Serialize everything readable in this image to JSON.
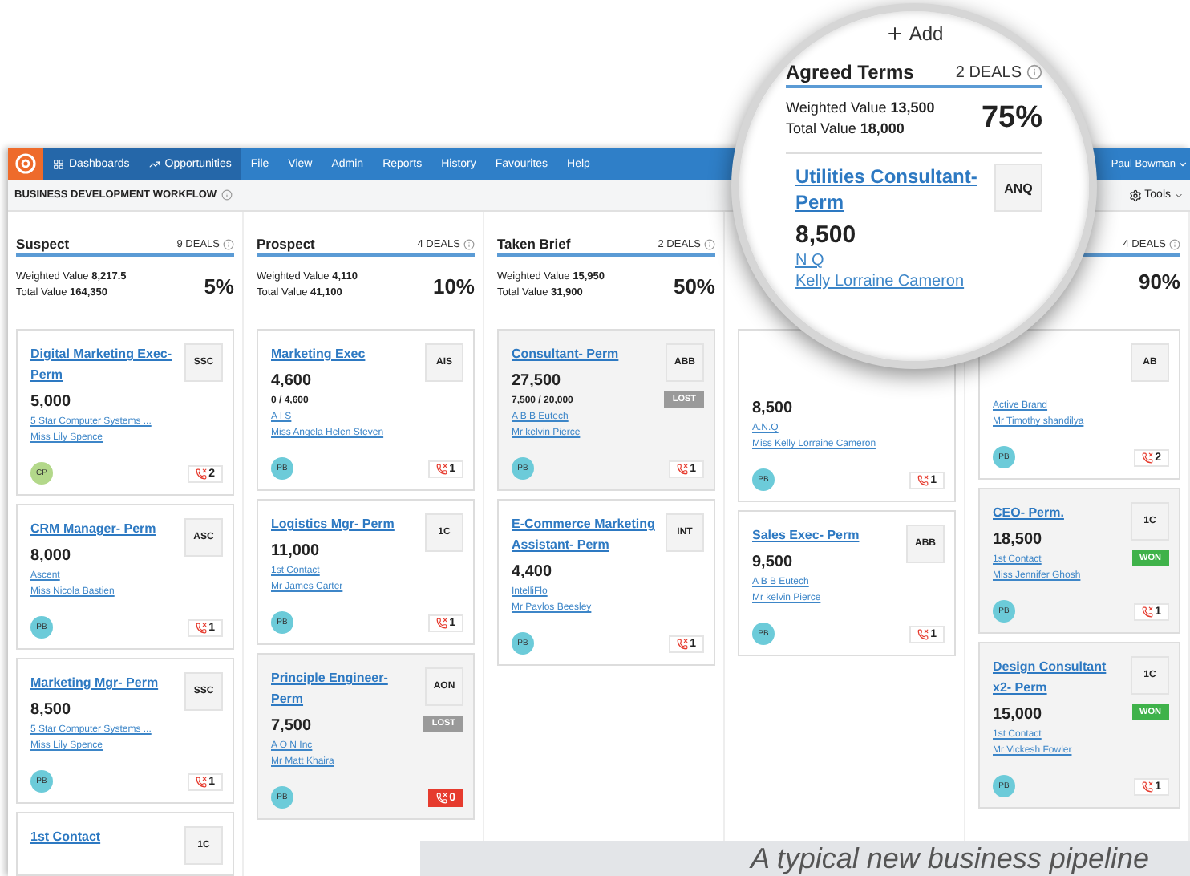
{
  "nav": {
    "items": [
      {
        "label": "Dashboards",
        "kind": "grid",
        "selected": true
      },
      {
        "label": "Opportunities",
        "kind": "trend",
        "selected": true
      },
      {
        "label": "File",
        "selected": false
      },
      {
        "label": "View",
        "selected": false
      },
      {
        "label": "Admin",
        "selected": false
      },
      {
        "label": "Reports",
        "selected": false
      },
      {
        "label": "History",
        "selected": false
      },
      {
        "label": "Favourites",
        "selected": false
      },
      {
        "label": "Help",
        "selected": false
      }
    ],
    "user": "Paul Bowman"
  },
  "toolbar": {
    "title": "BUSINESS DEVELOPMENT WORKFLOW",
    "tools": "Tools"
  },
  "columns": [
    {
      "title": "Suspect",
      "deals": "9 DEALS",
      "weighted_label": "Weighted Value",
      "weighted": "8,217.5",
      "total_label": "Total Value",
      "total": "164,350",
      "percent": "5%",
      "cards": [
        {
          "title": "Digital Marketing Exec- Perm",
          "badge": "SSC",
          "amount": "5,000",
          "company": "5 Star Computer Systems ...",
          "contact": "Miss Lily Spence",
          "owner": {
            "initials": "CP",
            "color": "#b3d88a"
          },
          "calls": "2",
          "alert": false
        },
        {
          "title": "CRM Manager- Perm",
          "badge": "ASC",
          "amount": "8,000",
          "company": "Ascent",
          "contact": "Miss Nicola Bastien",
          "owner": {
            "initials": "PB",
            "color": "#6ccbd9"
          },
          "calls": "1",
          "alert": false
        },
        {
          "title": "Marketing Mgr- Perm",
          "badge": "SSC",
          "amount": "8,500",
          "company": "5 Star Computer Systems ...",
          "contact": "Miss Lily Spence",
          "owner": {
            "initials": "PB",
            "color": "#6ccbd9"
          },
          "calls": "1",
          "alert": false
        },
        {
          "title": "1st Contact",
          "badge": "1C"
        }
      ]
    },
    {
      "title": "Prospect",
      "deals": "4 DEALS",
      "weighted_label": "Weighted Value",
      "weighted": "4,110",
      "total_label": "Total Value",
      "total": "41,100",
      "percent": "10%",
      "cards": [
        {
          "title": "Marketing Exec",
          "badge": "AIS",
          "amount": "4,600",
          "split": "0 / 4,600",
          "company": "A I S",
          "contact": "Miss Angela Helen Steven",
          "owner": {
            "initials": "PB",
            "color": "#6ccbd9"
          },
          "calls": "1",
          "alert": false
        },
        {
          "title": "Logistics Mgr- Perm",
          "badge": "1C",
          "amount": "11,000",
          "company": "1st Contact",
          "contact": "Mr James Carter",
          "owner": {
            "initials": "PB",
            "color": "#6ccbd9"
          },
          "calls": "1",
          "alert": false
        },
        {
          "title": "Principle Engineer- Perm",
          "badge": "AON",
          "kind": "lost",
          "status_label": "LOST",
          "amount": "7,500",
          "company": "A O N Inc",
          "contact": "Mr Matt Khaira",
          "owner": {
            "initials": "PB",
            "color": "#6ccbd9"
          },
          "calls": "0",
          "alert": true
        }
      ]
    },
    {
      "title": "Taken Brief",
      "deals": "2 DEALS",
      "weighted_label": "Weighted Value",
      "weighted": "15,950",
      "total_label": "Total Value",
      "total": "31,900",
      "percent": "50%",
      "cards": [
        {
          "title": "Consultant- Perm",
          "badge": "ABB",
          "kind": "lost",
          "status_label": "LOST",
          "amount": "27,500",
          "split": "7,500 / 20,000",
          "company": "A B B Eutech",
          "contact": "Mr kelvin Pierce",
          "owner": {
            "initials": "PB",
            "color": "#6ccbd9"
          },
          "calls": "1",
          "alert": false
        },
        {
          "title": "E-Commerce Marketing Assistant- Perm",
          "badge": "INT",
          "amount": "4,400",
          "company": "IntelliFlo",
          "contact": "Mr Pavlos Beesley",
          "owner": {
            "initials": "PB",
            "color": "#6ccbd9"
          },
          "calls": "1",
          "alert": false
        }
      ]
    },
    {
      "cards": [
        {
          "amount": "8,500",
          "company": "A.N.Q",
          "contact": "Miss Kelly Lorraine Cameron",
          "owner": {
            "initials": "PB",
            "color": "#6ccbd9"
          },
          "calls": "1",
          "alert": false
        },
        {
          "title": "Sales Exec- Perm",
          "badge": "ABB",
          "amount": "9,500",
          "company": "A B B Eutech",
          "contact": "Mr kelvin Pierce",
          "owner": {
            "initials": "PB",
            "color": "#6ccbd9"
          },
          "calls": "1",
          "alert": false
        }
      ]
    },
    {
      "deals": "4 DEALS",
      "percent": "90%",
      "cards": [
        {
          "badge": "AB",
          "company": "Active Brand",
          "contact": "Mr Timothy shandilya",
          "owner": {
            "initials": "PB",
            "color": "#6ccbd9"
          },
          "calls": "2",
          "alert": false
        },
        {
          "title": "CEO- Perm.",
          "badge": "1C",
          "kind": "won",
          "status_label": "WON",
          "amount": "18,500",
          "company": "1st Contact",
          "contact": "Miss Jennifer Ghosh",
          "owner": {
            "initials": "PB",
            "color": "#6ccbd9"
          },
          "calls": "1",
          "alert": false
        },
        {
          "title": "Design Consultant x2- Perm",
          "badge": "1C",
          "kind": "won",
          "status_label": "WON",
          "amount": "15,000",
          "company": "1st Contact",
          "contact": "Mr Vickesh Fowler",
          "owner": {
            "initials": "PB",
            "color": "#6ccbd9"
          },
          "calls": "1",
          "alert": false
        }
      ]
    }
  ],
  "magnifier": {
    "add": "Add",
    "title": "Agreed Terms",
    "deals": "2 DEALS",
    "weighted_label": "Weighted Value",
    "weighted": "13,500",
    "total_label": "Total Value",
    "total": "18,000",
    "percent": "75%",
    "card": {
      "title": "Utilities Consultant- Perm",
      "badge": "ANQ",
      "amount": "8,500",
      "company": "N Q",
      "contact": "Kelly Lorraine Cameron"
    }
  },
  "caption": "A typical new business pipeline"
}
